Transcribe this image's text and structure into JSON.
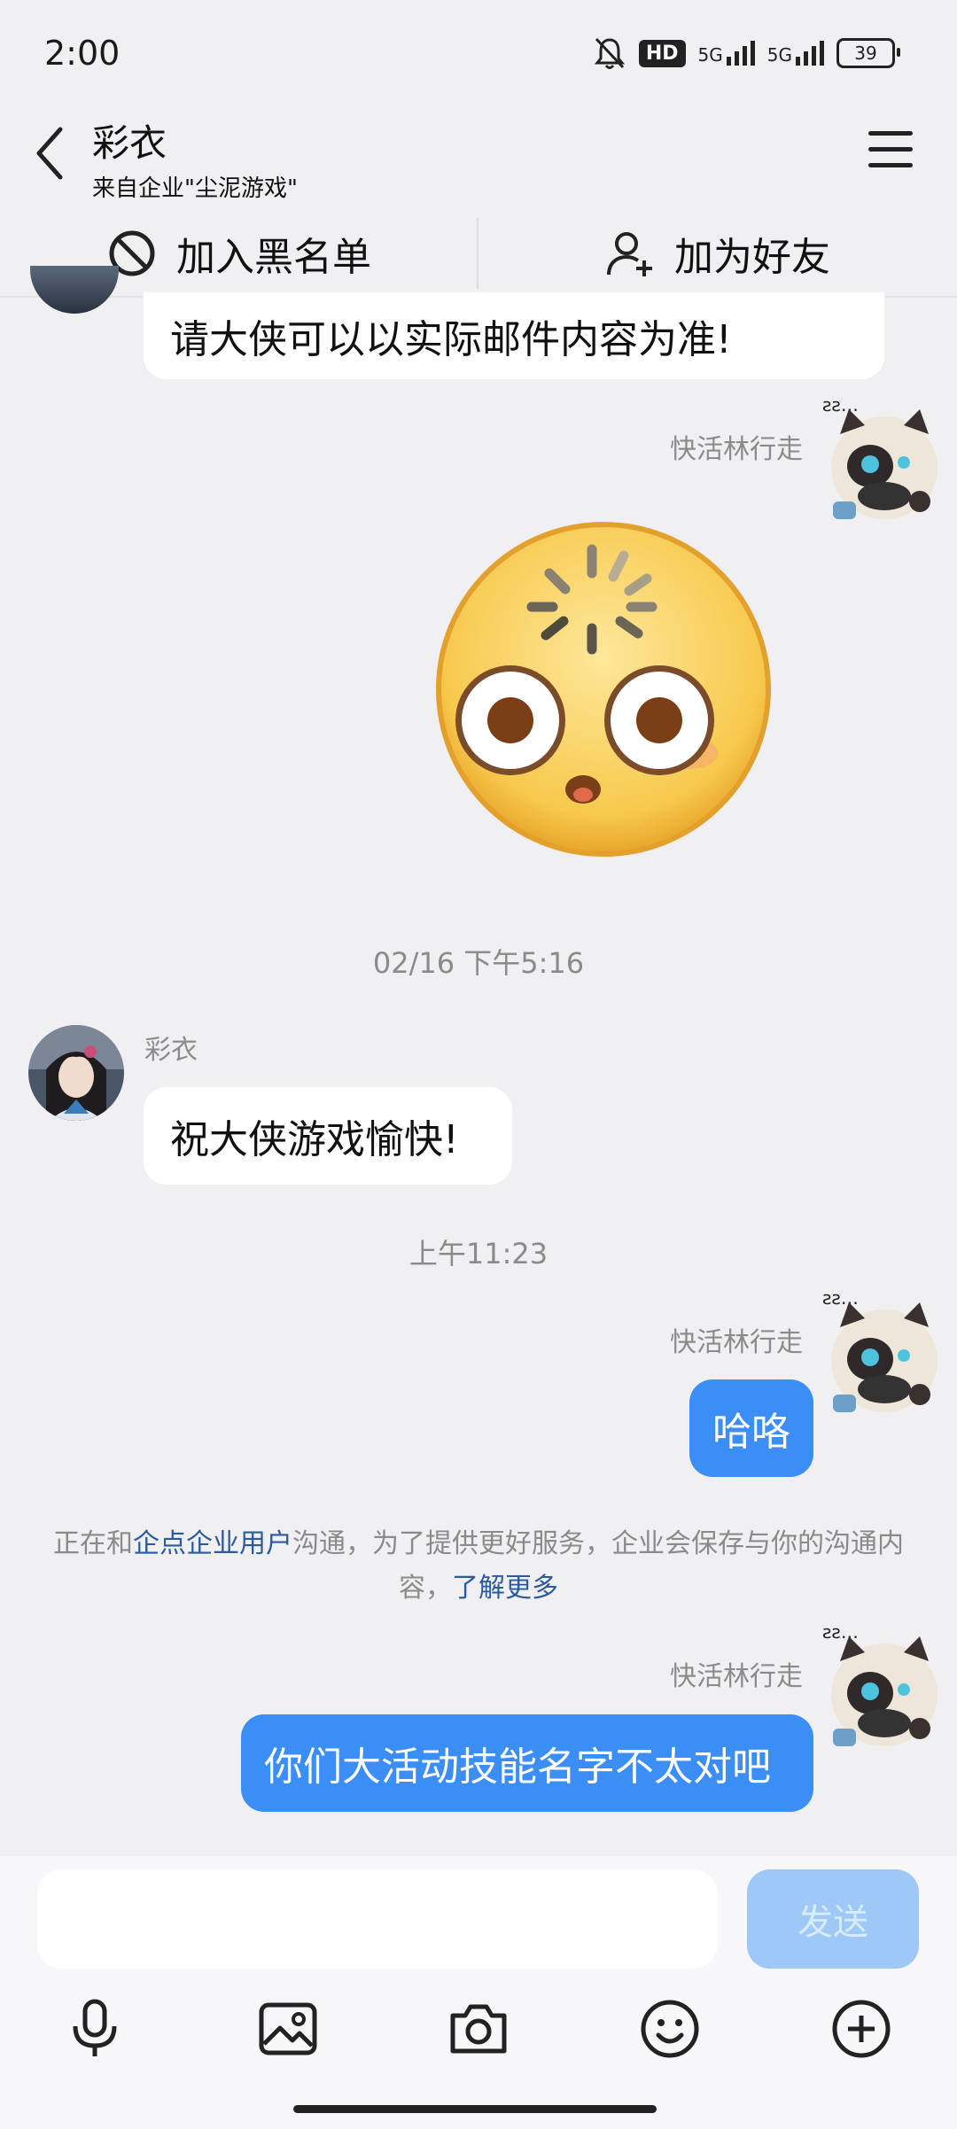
{
  "status_bar": {
    "time": "2:00",
    "hd": "HD",
    "net1": "5G",
    "net2": "5G",
    "battery": "39"
  },
  "header": {
    "name": "彩衣",
    "subtitle": "来自企业\"尘泥游戏\""
  },
  "actions": {
    "block": "加入黑名单",
    "add_friend": "加为好友"
  },
  "messages": {
    "m1_text": "请大侠可以以实际邮件内容为准!",
    "me_name": "快活林行走",
    "time1": "02/16 下午5:16",
    "contact_name": "彩衣",
    "m2_text": "祝大侠游戏愉快!",
    "time2": "上午11:23",
    "m3_text": "哈咯",
    "notice_pre": "正在和",
    "notice_link1": "企点企业用户",
    "notice_mid": "沟通，为了提供更好服务，企业会保存与你的沟通内容，",
    "notice_link2": "了解更多",
    "m4_text": "你们大活动技能名字不太对吧"
  },
  "input": {
    "placeholder": "",
    "send": "发送"
  },
  "colors": {
    "accent": "#3b8ef5",
    "link": "#2c5aa0",
    "bg": "#f0f0f3"
  }
}
